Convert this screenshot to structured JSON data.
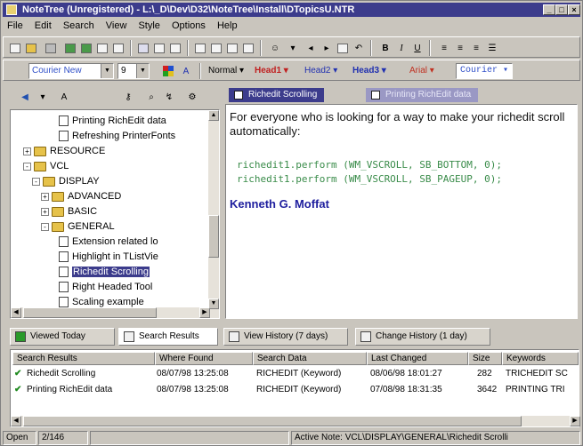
{
  "window": {
    "title": "NoteTree (Unregistered) - L:\\_D\\Dev\\D32\\NoteTree\\Install\\DTopicsU.NTR"
  },
  "menu": [
    "File",
    "Edit",
    "Search",
    "View",
    "Style",
    "Options",
    "Help"
  ],
  "format": {
    "font": "Courier New",
    "size": "9"
  },
  "styles": [
    {
      "label": "Normal",
      "color": "#000000"
    },
    {
      "label": "Head1",
      "color": "#c02020"
    },
    {
      "label": "Head2",
      "color": "#2030b0"
    },
    {
      "label": "Head3",
      "color": "#2030b0"
    },
    {
      "label": "Arial",
      "color": "#c03020"
    },
    {
      "label": "Courier",
      "color": "#3050c8"
    }
  ],
  "tree": [
    {
      "label": "Printing RichEdit data",
      "type": "doc",
      "indent": 5
    },
    {
      "label": "Refreshing PrinterFonts",
      "type": "doc",
      "indent": 5
    },
    {
      "label": "RESOURCE",
      "type": "folder",
      "indent": 1,
      "toggle": "+"
    },
    {
      "label": "VCL",
      "type": "folder",
      "indent": 1,
      "toggle": "-"
    },
    {
      "label": "DISPLAY",
      "type": "folder",
      "indent": 2,
      "toggle": "-"
    },
    {
      "label": "ADVANCED",
      "type": "folder",
      "indent": 3,
      "toggle": "+"
    },
    {
      "label": "BASIC",
      "type": "folder",
      "indent": 3,
      "toggle": "+"
    },
    {
      "label": "GENERAL",
      "type": "folder",
      "indent": 3,
      "toggle": "-"
    },
    {
      "label": "Extension related lo",
      "type": "doc",
      "indent": 5
    },
    {
      "label": "Highlight in TListVie",
      "type": "doc",
      "indent": 5
    },
    {
      "label": "Richedit Scrolling",
      "type": "doc",
      "indent": 5,
      "selected": true
    },
    {
      "label": "Right Headed Tool",
      "type": "doc",
      "indent": 5
    },
    {
      "label": "Scaling example",
      "type": "doc",
      "indent": 5
    }
  ],
  "tabs": [
    "Richedit Scrolling",
    "Printing RichEdit data"
  ],
  "note": {
    "text": "For everyone who is looking for a way to make your richedit scroll automatically:",
    "code1": "richedit1.perform (WM_VSCROLL, SB_BOTTOM, 0);",
    "code2": "richedit1.perform (WM_VSCROLL, SB_PAGEUP, 0);",
    "author": "Kenneth G. Moffat"
  },
  "bottom_tabs": [
    "Viewed Today",
    "Search Results",
    "View History (7 days)",
    "Change History (1 day)"
  ],
  "results": {
    "headers": [
      "Search Results",
      "Where Found",
      "Search Data",
      "Last Changed",
      "Size",
      "Keywords"
    ],
    "rows": [
      {
        "name": "Richedit Scrolling",
        "where": "08/07/98 13:25:08",
        "data": "RICHEDIT (Keyword)",
        "changed": "08/06/98 18:01:27",
        "size": "282",
        "keywords": "TRICHEDIT SC"
      },
      {
        "name": "Printing RichEdit data",
        "where": "08/07/98 13:25:08",
        "data": "RICHEDIT (Keyword)",
        "changed": "07/08/98 18:31:35",
        "size": "3642",
        "keywords": "PRINTING TRI"
      }
    ]
  },
  "status": {
    "mode": "Open",
    "count": "2/146",
    "active_note": "Active Note: VCL\\DISPLAY\\GENERAL\\Richedit Scrolli"
  }
}
